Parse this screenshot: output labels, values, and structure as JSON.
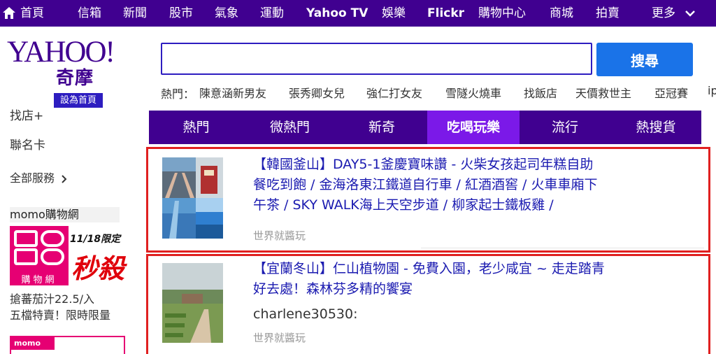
{
  "nav": {
    "items": [
      "首頁",
      "信箱",
      "新聞",
      "股市",
      "氣象",
      "運動",
      "Yahoo TV",
      "娛樂",
      "Flickr",
      "購物中心",
      "商城",
      "拍賣",
      "更多"
    ]
  },
  "header": {
    "logo_text": "YAHOO!",
    "logo_sub": "奇摩",
    "set_home": "設為首頁",
    "search_button": "搜尋",
    "search_value": "",
    "hot_label": "熱門：",
    "hot_items": [
      "陳意涵新男友",
      "張秀卿女兒",
      "強仁打女友",
      "雪隧火燒車",
      "找飯店",
      "天價救世主",
      "亞冠賽",
      "ip"
    ]
  },
  "sidebar": {
    "items": [
      "找店+",
      "聯名卡",
      "全部服務"
    ],
    "momo_title": "momo購物網",
    "momo_promo_date": "11/18限定",
    "momo_promo_word": "秒殺",
    "momo_tile_text": "購物網",
    "momo_desc_line1": "搶蕃茄汁22.5/入",
    "momo_desc_line2": "五檔特賣！限時限量",
    "momo_bottom_logo": "momo"
  },
  "tabs": [
    {
      "label": "熱門",
      "active": false
    },
    {
      "label": "微熱門",
      "active": false
    },
    {
      "label": "新奇",
      "active": false
    },
    {
      "label": "吃喝玩樂",
      "active": true
    },
    {
      "label": "流行",
      "active": false
    },
    {
      "label": "熱搜貨",
      "active": false
    }
  ],
  "articles": [
    {
      "title_lines": [
        "【韓國釜山】DAY5-1釜慶寶味讚 - 火柴女孩起司年糕自助",
        "餐吃到飽 / 金海洛東江鐵道自行車 / 紅酒酒窖 / 火車車廂下",
        "午茶 / SKY WALK海上天空步道 / 柳家起士鐵板雞 /"
      ],
      "author": "",
      "source": "世界就醬玩"
    },
    {
      "title_lines": [
        "【宜蘭冬山】仁山植物園 - 免費入園，老少咸宜 ~ 走走踏青",
        "好去處！森林芬多精的饗宴"
      ],
      "author": "charlene30530:",
      "source": "世界就醬玩"
    }
  ],
  "colors": {
    "brand": "#400090",
    "active_tab": "#7b19e8",
    "link": "#1a1ab0",
    "highlight": "#e02020",
    "search_btn": "#1a73e8"
  }
}
